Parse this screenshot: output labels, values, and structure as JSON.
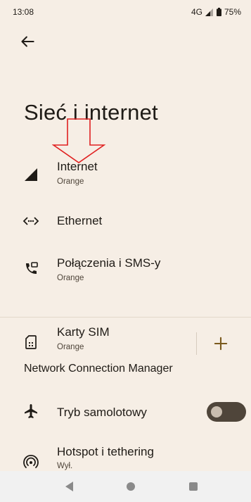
{
  "status_bar": {
    "time": "13:08",
    "network": "4G",
    "battery": "75%",
    "battery_level": 0.75
  },
  "header": {
    "back_icon": "arrow-left-icon",
    "title": "Sieć i internet"
  },
  "items": [
    {
      "title": "Internet",
      "subtitle": "Orange",
      "icon": "signal-icon"
    },
    {
      "title": "Ethernet",
      "subtitle": "",
      "icon": "ethernet-icon"
    },
    {
      "title": "Połączenia i SMS-y",
      "subtitle": "Orange",
      "icon": "calls-sms-icon"
    },
    {
      "title": "Karty SIM",
      "subtitle": "Orange",
      "icon": "sim-card-icon",
      "action_icon": "plus-icon"
    }
  ],
  "section": {
    "title": "Network Connection Manager"
  },
  "airplane": {
    "title": "Tryb samolotowy",
    "icon": "airplane-icon",
    "enabled": false
  },
  "hotspot": {
    "title": "Hotspot i tethering",
    "subtitle": "Wył.",
    "icon": "hotspot-icon"
  },
  "colors": {
    "background": "#F6EEE5",
    "text": "#1F1B16",
    "accent": "#7A5A1D",
    "annotation": "#E02020"
  }
}
